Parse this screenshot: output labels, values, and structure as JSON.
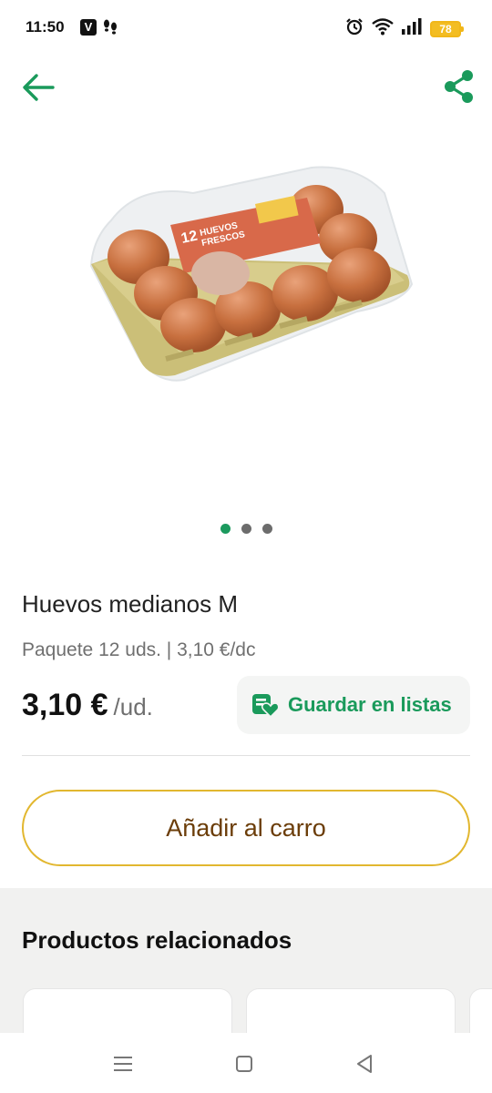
{
  "status_bar": {
    "time": "11:50",
    "app_badge": "V",
    "icons": [
      "v-app-icon",
      "footsteps-icon",
      "alarm-icon",
      "wifi-icon",
      "signal-icon",
      "battery-icon"
    ],
    "battery_level": "78"
  },
  "app_bar": {
    "back_icon": "arrow-left-icon",
    "share_icon": "share-icon",
    "accent_color": "#1a9a5b"
  },
  "gallery": {
    "image": "egg-carton-photo",
    "total_images": 3,
    "active_index": 0
  },
  "product": {
    "name": "Huevos medianos M",
    "unit_info": "Paquete 12 uds. | 3,10 €/dc",
    "price": "3,10 €",
    "price_unit": "/ud."
  },
  "save_lists": {
    "icon": "list-heart-icon",
    "label": "Guardar en listas"
  },
  "cart": {
    "label": "Añadir al carro",
    "border_color": "#e2b72f",
    "text_color": "#6b3d09"
  },
  "related": {
    "title": "Productos relacionados"
  },
  "nav_bar": {
    "icons": [
      "recent-apps-icon",
      "home-icon",
      "back-icon"
    ]
  }
}
